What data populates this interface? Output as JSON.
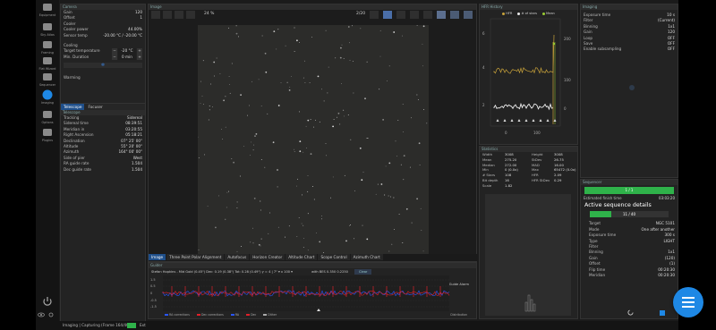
{
  "nav": {
    "items": [
      {
        "label": "Equipment",
        "icon": "camera-icon"
      },
      {
        "label": "Sky Atlas",
        "icon": "telescope-icon"
      },
      {
        "label": "Framing",
        "icon": "framing-icon"
      },
      {
        "label": "Flat Wizard",
        "icon": "flat-wizard-icon"
      },
      {
        "label": "Sequencer",
        "icon": "sequencer-icon"
      },
      {
        "label": "Imaging",
        "icon": "imaging-icon"
      },
      {
        "label": "Options",
        "icon": "options-icon"
      },
      {
        "label": "Plugins",
        "icon": "plugins-icon"
      }
    ]
  },
  "camera": {
    "title": "Camera",
    "rows": [
      {
        "k": "Gain",
        "v": "120"
      },
      {
        "k": "Offset",
        "v": "1"
      },
      {
        "k": "Cooler",
        "v": ""
      },
      {
        "k": "Cooler power",
        "v": "44.00%"
      },
      {
        "k": "Sensor temp",
        "v": "-20.00 °C / -20.00 °C"
      }
    ],
    "cooling_label": "Cooling",
    "target_temp_label": "Target temperature",
    "target_temp_value": "-20 °C",
    "min_duration_label": "Min. Duration",
    "min_duration_value": "0 min",
    "warming_label": "Warming"
  },
  "telescope": {
    "tabs": [
      "Telescope",
      "Focuser"
    ],
    "title": "Telescope",
    "rows": [
      {
        "k": "Tracking",
        "v": "Sidereal"
      },
      {
        "k": "Sidereal time",
        "v": "08:39:51"
      },
      {
        "k": "Meridian in",
        "v": "03:20:55"
      },
      {
        "k": "Right Ascension",
        "v": "05:18:21"
      },
      {
        "k": "Declination",
        "v": "07° 25' 00\""
      },
      {
        "k": "Altitude",
        "v": "55° 20' 00\""
      },
      {
        "k": "Azimuth",
        "v": "164° 00' 00\""
      },
      {
        "k": "Side of pier",
        "v": "West"
      },
      {
        "k": "RA guide rate",
        "v": "1.504"
      },
      {
        "k": "Dec guide rate",
        "v": "1.504"
      }
    ]
  },
  "image": {
    "title": "Image",
    "zoom": "24 %",
    "frame_count": "2/20",
    "bottom_tabs": [
      "Image",
      "Three Point Polar Alignment",
      "Autofocus",
      "Horizon Creator",
      "Altitude Chart",
      "Scope Control",
      "Azimuth Chart"
    ]
  },
  "guider": {
    "title": "Guider",
    "info": "Stefan Hopkins - Mid Gold (0.45\") Dec: 0.19 (0.38\") Tot: 0.28 (0.49\") y = 4 | 7\" ▾ x 100 ▾",
    "scale_label": "with BES 0.350 0.2250",
    "clear_label": "Clear",
    "yaxis": [
      "1.5",
      "0.5",
      "0",
      "-0.5",
      "-1.5"
    ],
    "legend": [
      "RA corrections",
      "Dec corrections",
      "RA",
      "Dec",
      "Dither"
    ],
    "algo_label": "Guide Alarm",
    "dist_label": "Distribution"
  },
  "hfr": {
    "title": "HFR History",
    "legend": [
      "HFR",
      "# of stars",
      "Mean"
    ],
    "yleft": [
      "6",
      "4",
      "2"
    ],
    "yright": [
      "200",
      "100",
      "0"
    ],
    "xaxis": [
      "0",
      "100"
    ]
  },
  "statistics": {
    "title": "Statistics",
    "rows": [
      {
        "k": "Width",
        "v": "3008",
        "k2": "Height",
        "v2": "3008"
      },
      {
        "k": "Mean",
        "v": "275.20",
        "k2": "StDev",
        "v2": "26.75"
      },
      {
        "k": "Median",
        "v": "272.00",
        "k2": "MAD",
        "v2": "16.00"
      },
      {
        "k": "Min",
        "v": "0 (0.0x)",
        "k2": "Max",
        "v2": "65472 (0.0x)"
      },
      {
        "k": "# Stars",
        "v": "108",
        "k2": "HFR",
        "v2": "2.09"
      },
      {
        "k": "Bit depth",
        "v": "16",
        "k2": "HFR StDev",
        "v2": "0.29"
      },
      {
        "k": "Scale",
        "v": "1.82",
        "k2": "",
        "v2": ""
      }
    ]
  },
  "imaging": {
    "title": "Imaging",
    "rows": [
      {
        "k": "Exposure time",
        "v": "10 s"
      },
      {
        "k": "Filter",
        "v": "(Current)"
      },
      {
        "k": "Binning",
        "v": "1x1"
      },
      {
        "k": "Gain",
        "v": "120"
      },
      {
        "k": "Loop",
        "v": "OFF"
      },
      {
        "k": "Save",
        "v": "OFF"
      },
      {
        "k": "Enable subsampling",
        "v": "OFF"
      }
    ]
  },
  "sequence": {
    "title": "Sequencer",
    "progress_text": "1 / 1",
    "progress_fraction": 1.0,
    "estimated_finish_label": "Estimated finish time",
    "estimated_finish_value": "03:03:20",
    "active_title": "Active sequence details",
    "inner_progress_text": "11 / 40",
    "inner_progress_fraction": 0.275,
    "rows": [
      {
        "k": "Target",
        "v": "NGC 5101"
      },
      {
        "k": "Mode",
        "v": "One after another"
      },
      {
        "k": "Exposure time",
        "v": "300 s"
      },
      {
        "k": "Type",
        "v": "LIGHT"
      },
      {
        "k": "Filter",
        "v": ""
      },
      {
        "k": "Binning",
        "v": "1x1"
      },
      {
        "k": "Gain",
        "v": "(120)"
      },
      {
        "k": "Offset",
        "v": "(1)"
      },
      {
        "k": "Flip time",
        "v": "00:20:30"
      },
      {
        "k": "Meridian",
        "v": "00:20:30"
      }
    ]
  },
  "status_bar": {
    "text": "Imaging | Capturing (Frame 164/40)",
    "state": "Ext"
  },
  "colors": {
    "accent": "#1e88e5",
    "guide_ra": "#2a56ff",
    "guide_dec": "#e0202a",
    "hfr": "#c9a33a",
    "progress": "#2fb24a"
  }
}
